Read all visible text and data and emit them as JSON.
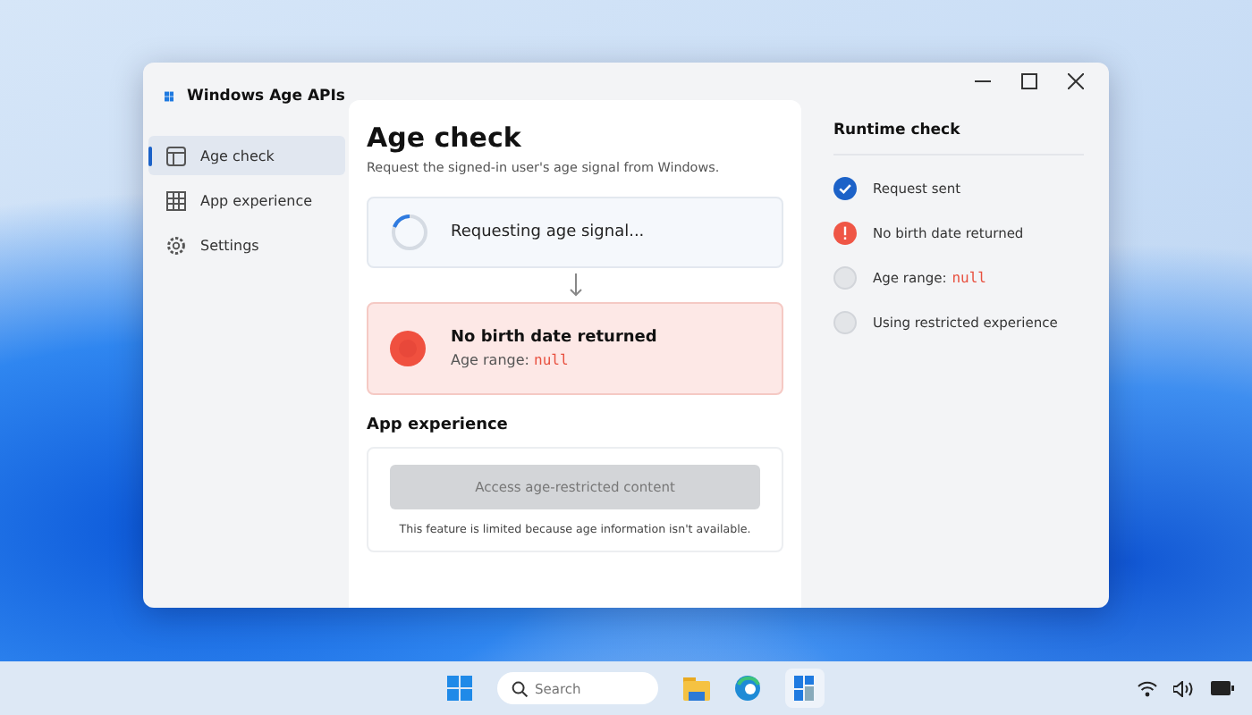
{
  "window": {
    "title": "Windows Age APIs"
  },
  "sidebar": {
    "items": [
      {
        "label": "Age check",
        "kind": "panel",
        "selected": true
      },
      {
        "label": "App experience",
        "kind": "grid",
        "selected": false
      },
      {
        "label": "Settings",
        "kind": "gear",
        "selected": false
      }
    ]
  },
  "main": {
    "title": "Age check",
    "subtitle": "Request the signed-in user's age signal from Windows.",
    "request": {
      "label": "Requesting age signal..."
    },
    "result": {
      "title": "No birth date returned",
      "label": "Age range:",
      "value": "null"
    },
    "section": "App experience",
    "experience": {
      "button": "Access age-restricted content",
      "disabled": true,
      "note": "This feature is limited because age information isn't available."
    }
  },
  "runtime": {
    "title": "Runtime check",
    "items": [
      {
        "kind": "done",
        "label": "Request sent"
      },
      {
        "kind": "error",
        "label": "No birth date returned"
      },
      {
        "kind": "pending",
        "label": "Age range:",
        "value": "null"
      },
      {
        "kind": "pending",
        "label": "Using restricted experience"
      }
    ]
  },
  "taskbar": {
    "search": {
      "placeholder": "Search"
    }
  }
}
